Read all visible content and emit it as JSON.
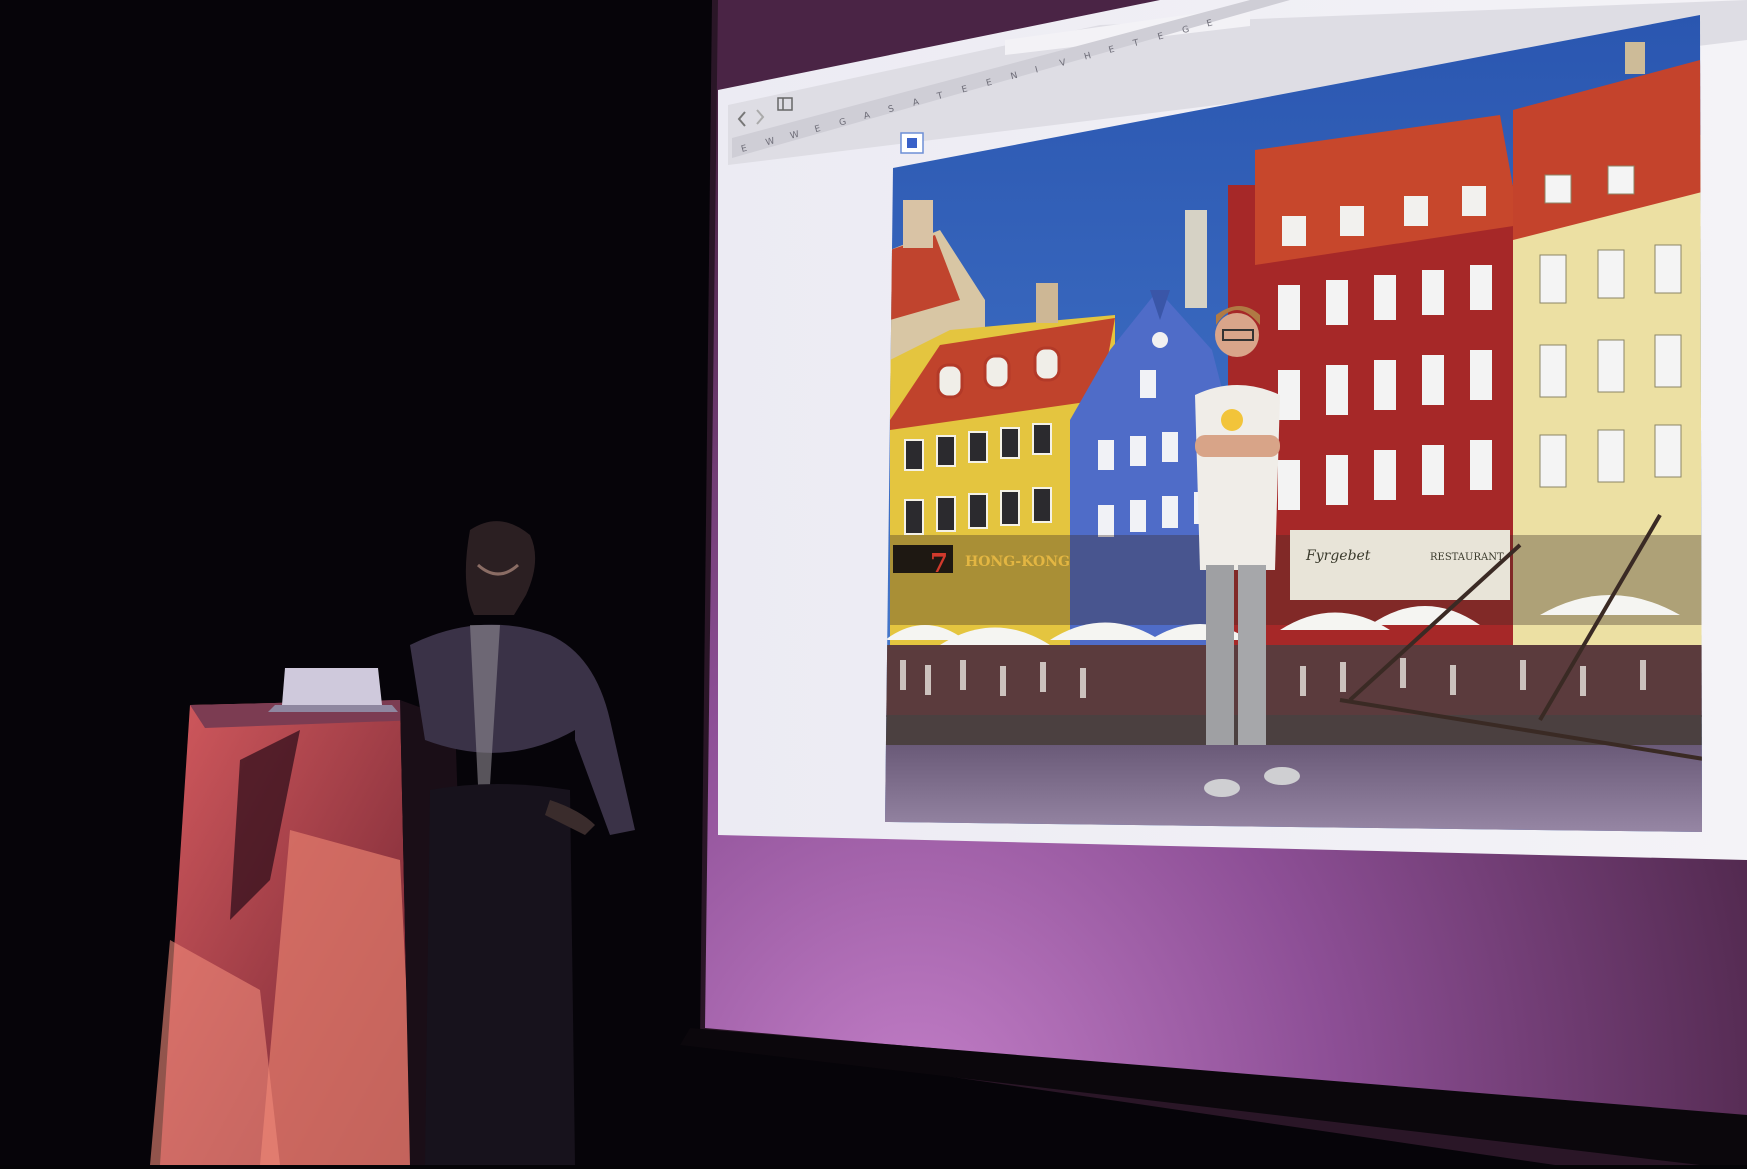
{
  "scene": {
    "kind": "conference talk photo",
    "presenter": "speaker-at-podium",
    "screen_content": "browser-window-with-photo"
  },
  "browser": {
    "back_icon": "chevron-left-icon",
    "forward_icon": "chevron-right-icon",
    "sidebar_icon": "sidebar-icon",
    "toolbar_icon": "expand-icon",
    "address_text": "",
    "bookmark_letters": [
      "E",
      "W",
      "W",
      "E",
      "G",
      "A",
      "S",
      "A",
      "T",
      "E",
      "E",
      "N",
      "I",
      "V",
      "H",
      "E",
      "T",
      "E",
      "G",
      "E"
    ]
  },
  "photo": {
    "signs": {
      "number": "7",
      "restaurant_name": "HONG-KONG",
      "cafe_sign": "Fyrgebet",
      "restaurant_sign": "RESTAURANT"
    }
  },
  "colors": {
    "sky": "#2f5fb6",
    "roof": "#c4412a",
    "yellow_facade": "#e7c73f",
    "blue_facade": "#4f6bc7",
    "red_facade": "#a42627",
    "cream_facade": "#ece0a4",
    "screen_glow": "#b06ab8",
    "podium": "#c4454b"
  }
}
